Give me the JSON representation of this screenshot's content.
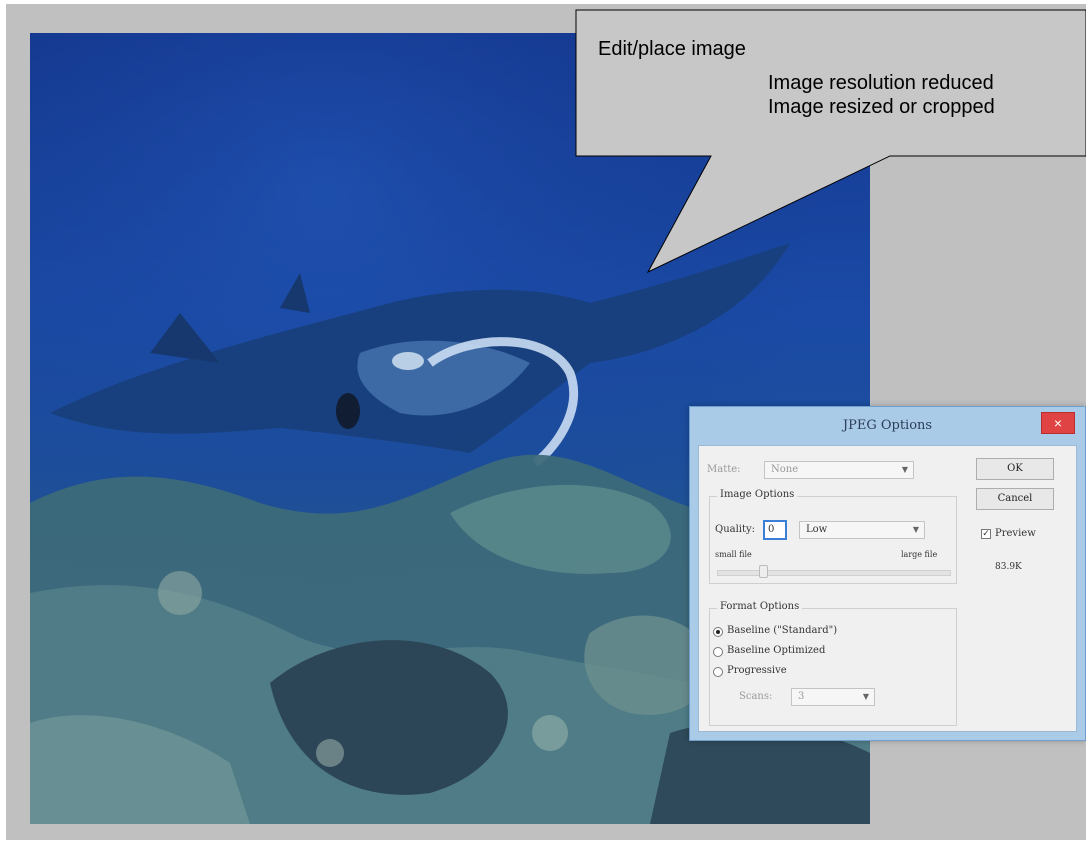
{
  "callout": {
    "heading": "Edit/place image",
    "line1": "Image resolution reduced",
    "line2": "Image resized or cropped"
  },
  "dialog": {
    "title": "JPEG Options",
    "close_glyph": "×",
    "matte_label": "Matte:",
    "matte_value": "None",
    "ok_label": "OK",
    "cancel_label": "Cancel",
    "preview_label": "Preview",
    "preview_checked": true,
    "file_size": "83.9K",
    "image_options": {
      "title": "Image Options",
      "quality_label": "Quality:",
      "quality_value": "0",
      "quality_preset": "Low",
      "small_file_label": "small file",
      "large_file_label": "large file",
      "slider_level_percent": 0
    },
    "format_options": {
      "title": "Format Options",
      "baseline_standard": "Baseline (\"Standard\")",
      "baseline_optimized": "Baseline Optimized",
      "progressive": "Progressive",
      "scans_label": "Scans:",
      "scans_value": "3",
      "selected": "baseline_standard"
    }
  },
  "colors": {
    "canvas_gray": "#c0c0c0",
    "callout_fill": "#c7c7c7",
    "dialog_frame": "#a9cbe8",
    "close_red": "#e04343"
  }
}
